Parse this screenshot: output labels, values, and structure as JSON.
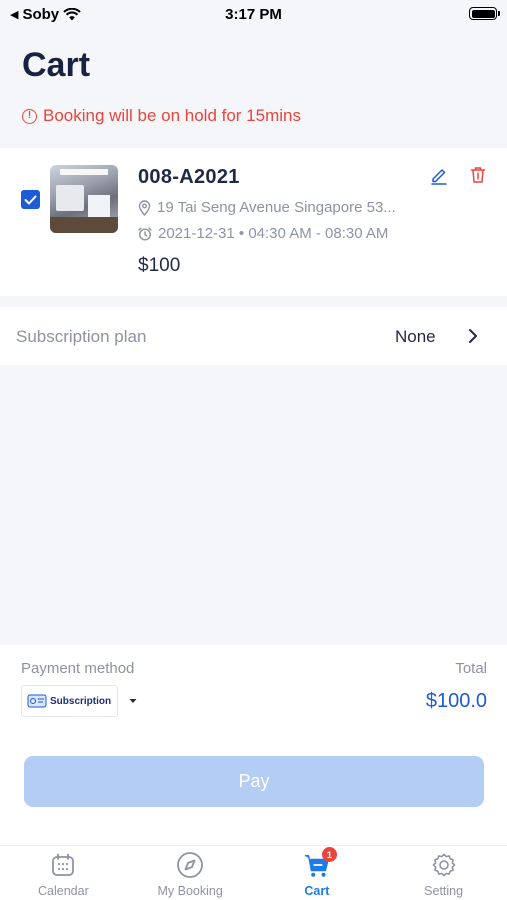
{
  "status_bar": {
    "back_app": "Soby",
    "time": "3:17 PM"
  },
  "page": {
    "title": "Cart",
    "hold_warning": "Booking will be on hold for 15mins"
  },
  "cart_item": {
    "checked": true,
    "name": "008-A2021",
    "address": "19 Tai Seng Avenue Singapore 53...",
    "datetime": "2021-12-31 • 04:30 AM - 08:30 AM",
    "price": "$100"
  },
  "subscription_plan": {
    "label": "Subscription plan",
    "value": "None"
  },
  "payment": {
    "method_label": "Payment method",
    "method_value": "Subscription",
    "total_label": "Total",
    "total_value": "$100.0",
    "pay_label": "Pay"
  },
  "tabs": [
    {
      "label": "Calendar",
      "icon": "calendar-icon",
      "active": false
    },
    {
      "label": "My Booking",
      "icon": "compass-icon",
      "active": false
    },
    {
      "label": "Cart",
      "icon": "cart-icon",
      "active": true,
      "badge": "1"
    },
    {
      "label": "Setting",
      "icon": "gear-icon",
      "active": false
    }
  ],
  "colors": {
    "accent": "#1e5bd6",
    "warning": "#e8453c",
    "pay_disabled": "#b4cdf5",
    "active_tab": "#1e7be8"
  }
}
